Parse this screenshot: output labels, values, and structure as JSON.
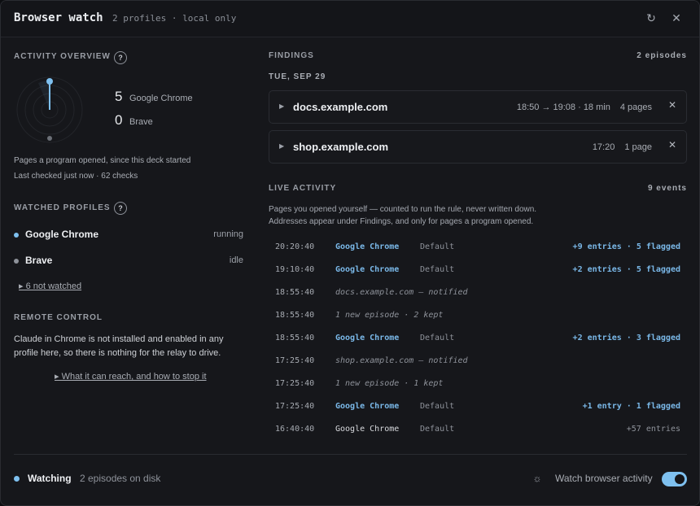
{
  "window": {
    "title": "Browser watch",
    "subtitle": "2 profiles · local only",
    "refresh_icon": "refresh-icon",
    "close_icon": "close-icon"
  },
  "overview": {
    "heading": "ACTIVITY OVERVIEW",
    "help": "?",
    "counts": [
      {
        "value": "5",
        "label": "Google Chrome"
      },
      {
        "value": "0",
        "label": "Brave"
      }
    ],
    "caption": "Pages a program opened, since this deck started",
    "last_checked": "Last checked just now · 62 checks"
  },
  "profiles": {
    "heading": "WATCHED PROFILES",
    "help": "?",
    "items": [
      {
        "name": "Google Chrome",
        "state": "running",
        "dot_color": "#7ec0ef"
      },
      {
        "name": "Brave",
        "state": "idle",
        "dot_color": "#8e929a"
      }
    ],
    "not_watched": "▸ 6 not watched"
  },
  "remote": {
    "heading": "REMOTE CONTROL",
    "text": "Claude in Chrome is not installed and enabled in any profile here, so there is nothing for the relay to drive.",
    "link": "▸ What it can reach, and how to stop it"
  },
  "findings": {
    "heading": "FINDINGS",
    "count": "2 episodes",
    "date": "TUE, SEP 29",
    "items": [
      {
        "host": "docs.example.com",
        "time": "18:50 → 19:08 · 18 min",
        "pages": "4 pages"
      },
      {
        "host": "shop.example.com",
        "time": "17:20",
        "pages": "1 page"
      }
    ]
  },
  "live": {
    "heading": "LIVE ACTIVITY",
    "count": "9 events",
    "note_1": "Pages you opened yourself — counted to run the rule, never written down.",
    "note_2": "Addresses appear under Findings, and only for pages a program opened.",
    "events": [
      {
        "time": "20:20:40",
        "who": "Google Chrome",
        "profile": "Default",
        "summary": "+9 entries · 5 flagged"
      },
      {
        "time": "19:10:40",
        "who": "Google Chrome",
        "profile": "Default",
        "summary": "+2 entries · 5 flagged"
      },
      {
        "time": "18:55:40",
        "message": "docs.example.com — notified"
      },
      {
        "time": "18:55:40",
        "message": "1 new episode · 2 kept"
      },
      {
        "time": "18:55:40",
        "who": "Google Chrome",
        "profile": "Default",
        "summary": "+2 entries · 3 flagged"
      },
      {
        "time": "17:25:40",
        "message": "shop.example.com — notified"
      },
      {
        "time": "17:25:40",
        "message": "1 new episode · 1 kept"
      },
      {
        "time": "17:25:40",
        "who": "Google Chrome",
        "profile": "Default",
        "summary": "+1 entry · 1 flagged"
      },
      {
        "time": "16:40:40",
        "who": "Google Chrome",
        "profile": "Default",
        "summary": "+57 entries",
        "plain": true
      }
    ]
  },
  "footer": {
    "state": "Watching",
    "sub": "2 episodes on disk",
    "toggle_label": "Watch browser activity",
    "toggle_on": true,
    "accent": "#7ec0ef"
  }
}
